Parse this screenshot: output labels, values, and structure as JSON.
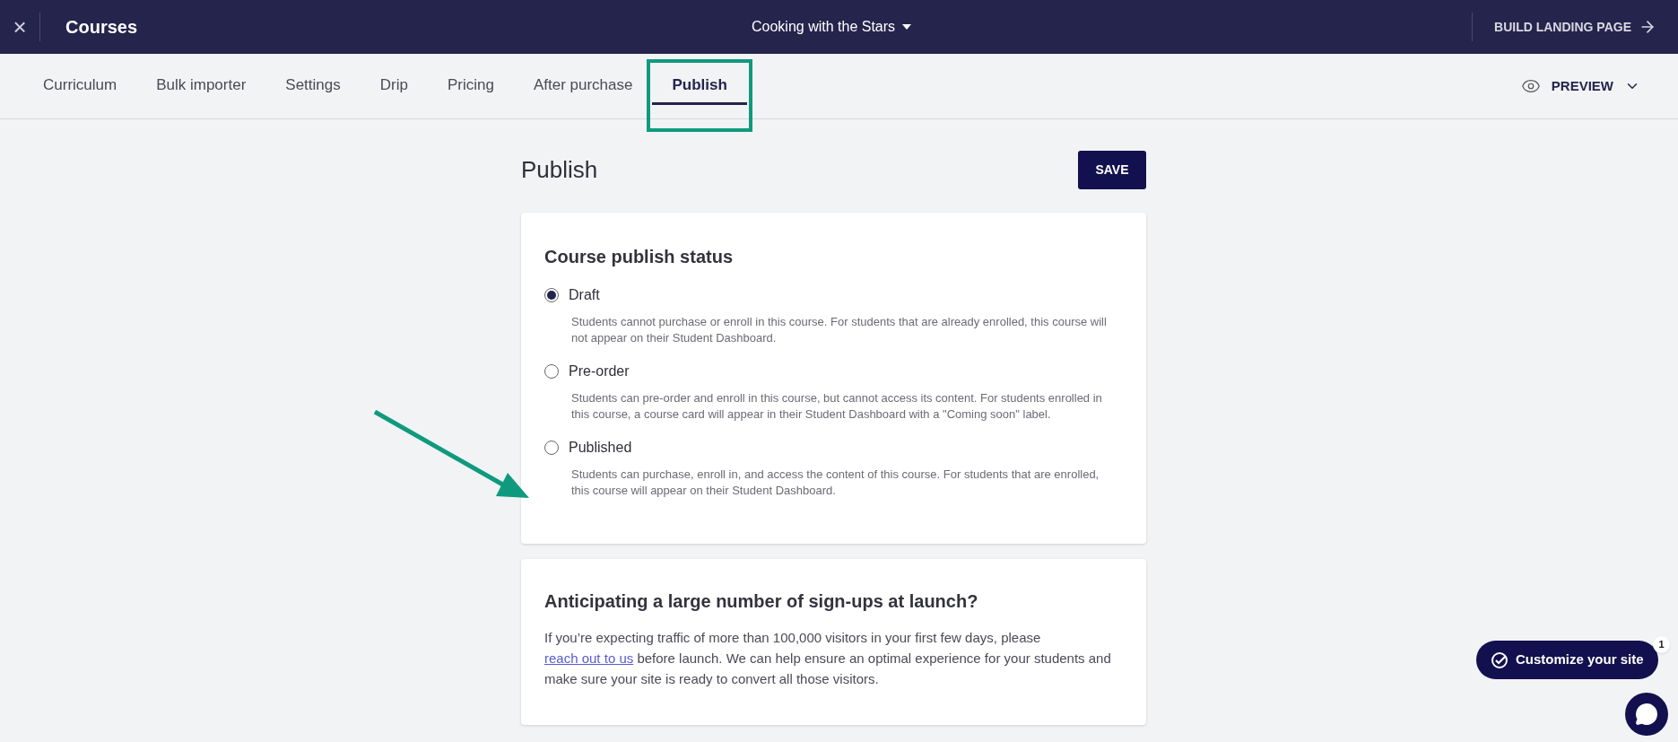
{
  "top_bar": {
    "close_icon": "×",
    "title": "Courses",
    "course_selector": "Cooking with the Stars",
    "action": "BUILD LANDING PAGE"
  },
  "tabs": [
    {
      "label": "Curriculum",
      "selected": false,
      "highlighted": false
    },
    {
      "label": "Bulk importer",
      "selected": false,
      "highlighted": false
    },
    {
      "label": "Settings",
      "selected": false,
      "highlighted": false
    },
    {
      "label": "Drip",
      "selected": false,
      "highlighted": false
    },
    {
      "label": "Pricing",
      "selected": false,
      "highlighted": false
    },
    {
      "label": "After purchase",
      "selected": false,
      "highlighted": false
    },
    {
      "label": "Publish",
      "selected": true,
      "highlighted": true
    }
  ],
  "preview": "PREVIEW",
  "page_title": "Publish",
  "save_button": "SAVE",
  "status_card": {
    "title": "Course publish status",
    "options": [
      {
        "label": "Draft",
        "selected": true,
        "pointed": false,
        "description": "Students cannot purchase or enroll in this course. For students that are already enrolled, this course will not appear on their Student Dashboard."
      },
      {
        "label": "Pre-order",
        "selected": false,
        "pointed": false,
        "description": "Students can pre-order and enroll in this course, but cannot access its content. For students enrolled in this course, a course card will appear in their Student Dashboard with a \"Coming soon\" label."
      },
      {
        "label": "Published",
        "selected": false,
        "pointed": true,
        "description": "Students can purchase, enroll in, and access the content of this course. For students that are enrolled, this course will appear on their Student Dashboard."
      }
    ]
  },
  "launch_card": {
    "title": "Anticipating a large number of sign-ups at launch?",
    "text_before": "If you’re expecting traffic of more than 100,000 visitors in your first few days, please",
    "link": "reach out to us",
    "text_after": "before launch. We can help ensure an optimal experience for your students and make sure your site is ready to convert all those visitors."
  },
  "customize_button": {
    "label": "Customize your site",
    "badge": "1"
  }
}
